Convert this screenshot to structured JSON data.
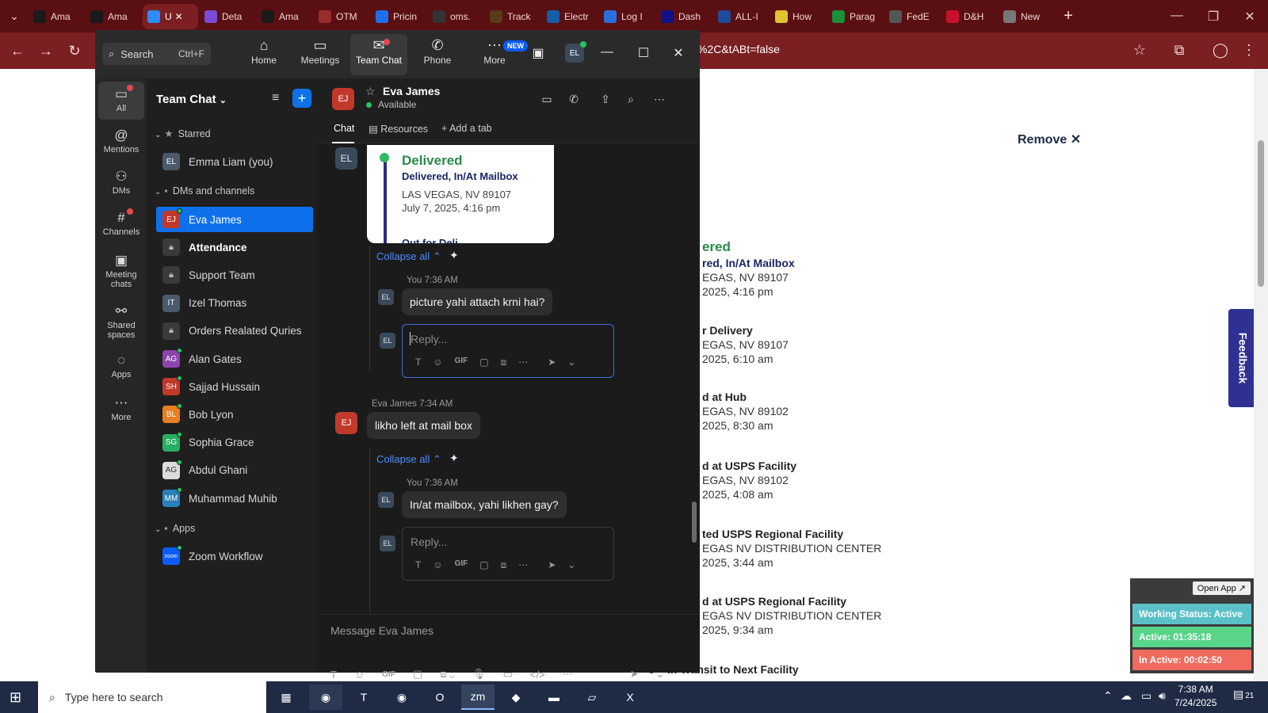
{
  "browser": {
    "tabs": [
      {
        "label": "Ama",
        "icon": "amazon-icon",
        "color": "#1a1a1a"
      },
      {
        "label": "Ama",
        "icon": "amazon-icon",
        "color": "#1a1a1a"
      },
      {
        "label": "U",
        "icon": "zoom-app-icon",
        "color": "#2d8cff",
        "active": true
      },
      {
        "label": "Deta",
        "icon": "page-icon",
        "color": "#7a4bd6"
      },
      {
        "label": "Ama",
        "icon": "amazon-icon",
        "color": "#1a1a1a"
      },
      {
        "label": "OTM",
        "icon": "otm-icon",
        "color": "#9b2c2c"
      },
      {
        "label": "Pricin",
        "icon": "pricing-icon",
        "color": "#1f6feb"
      },
      {
        "label": "oms.",
        "icon": "oms-icon",
        "color": "#333"
      },
      {
        "label": "Track",
        "icon": "ups-icon",
        "color": "#5a3a1a"
      },
      {
        "label": "Electr",
        "icon": "ec-icon",
        "color": "#145ea8"
      },
      {
        "label": "Log I",
        "icon": "login-icon",
        "color": "#2a6fdb"
      },
      {
        "label": "Dash",
        "icon": "dashboard-icon",
        "color": "#118"
      },
      {
        "label": "ALL-I",
        "icon": "seventeen-icon",
        "color": "#1f4a9c"
      },
      {
        "label": "How",
        "icon": "how-icon",
        "color": "#e0c32f"
      },
      {
        "label": "Parag",
        "icon": "sheets-icon",
        "color": "#1a8f3c"
      },
      {
        "label": "FedE",
        "icon": "fedex-icon",
        "color": "#555"
      },
      {
        "label": "D&H",
        "icon": "dh-icon",
        "color": "#c8102e"
      },
      {
        "label": "New",
        "icon": "newtab-icon",
        "color": "#777"
      }
    ],
    "url": "%2C&tABt=false"
  },
  "webpage": {
    "remove_label": "Remove ✕",
    "feedback_label": "Feedback",
    "tracking_events": [
      {
        "title": "ered",
        "line1": "red, In/At Mailbox",
        "line2": "EGAS, NV 89107",
        "line3": "2025, 4:16 pm",
        "green": true
      },
      {
        "title": "r Delivery",
        "line1": "EGAS, NV 89107",
        "line2": "2025, 6:10 am"
      },
      {
        "title": "d at Hub",
        "line1": "EGAS, NV 89102",
        "line2": "2025, 8:30 am"
      },
      {
        "title": "d at USPS Facility",
        "line1": "EGAS, NV 89102",
        "line2": "2025, 4:08 am"
      },
      {
        "title": "ted USPS Regional Facility",
        "line1": "EGAS NV DISTRIBUTION CENTER",
        "line2": "2025, 3:44 am"
      },
      {
        "title": "d at USPS Regional Facility",
        "line1": "EGAS NV DISTRIBUTION CENTER",
        "line2": "2025, 9:34 am"
      },
      {
        "title": "In Transit to Next Facility"
      }
    ],
    "status_widget": {
      "open_app": "Open App ↗",
      "working_status": "Working Status: Active",
      "active": "Active: 01:35:18",
      "inactive": "In Active: 00:02:50"
    }
  },
  "zoom": {
    "search_label": "Search",
    "search_shortcut": "Ctrl+F",
    "top_tabs": [
      {
        "label": "Home",
        "icon": "home-icon"
      },
      {
        "label": "Meetings",
        "icon": "video-icon"
      },
      {
        "label": "Team Chat",
        "icon": "chat-icon",
        "active": true
      },
      {
        "label": "Phone",
        "icon": "phone-icon"
      },
      {
        "label": "More",
        "icon": "more-icon"
      }
    ],
    "new_badge": "NEW",
    "avatar_initials": "EL",
    "rail": [
      {
        "label": "All",
        "icon": "chat-bubble-icon",
        "active": true
      },
      {
        "label": "Mentions",
        "icon": "at-icon"
      },
      {
        "label": "DMs",
        "icon": "people-icon"
      },
      {
        "label": "Channels",
        "icon": "hash-icon"
      },
      {
        "label": "Meeting chats",
        "icon": "calendar-icon"
      },
      {
        "label": "Shared spaces",
        "icon": "shared-icon"
      },
      {
        "label": "Apps",
        "icon": "apps-icon"
      },
      {
        "label": "More",
        "icon": "ellipsis-icon"
      }
    ],
    "list_title": "Team Chat",
    "sections": {
      "starred": "Starred",
      "dms": "DMs and channels",
      "apps": "Apps"
    },
    "starred_items": [
      {
        "initials": "EL",
        "name": "Emma Liam (you)",
        "color": "#4a5a6a"
      }
    ],
    "channels": [
      {
        "initials": "EJ",
        "name": "Eva James",
        "color": "#c0392b",
        "active": true,
        "online": true
      },
      {
        "name": "Attendance",
        "lock": true,
        "bold": true
      },
      {
        "name": "Support Team",
        "lock": true
      },
      {
        "initials": "IT",
        "name": "Izel Thomas",
        "color": "#4a5a6a"
      },
      {
        "name": "Orders Realated Quries",
        "lock": true
      },
      {
        "initials": "AG",
        "name": "Alan Gates",
        "color": "#8e44ad",
        "online": true
      },
      {
        "initials": "SH",
        "name": "Sajjad Hussain",
        "color": "#c0392b",
        "online": true
      },
      {
        "initials": "BL",
        "name": "Bob Lyon",
        "color": "#e67e22",
        "online": true
      },
      {
        "initials": "SG",
        "name": "Sophia Grace",
        "color": "#27ae60",
        "online": true
      },
      {
        "initials": "AG",
        "name": "Abdul Ghani",
        "color": "#dcdcdc",
        "online": true
      },
      {
        "initials": "MM",
        "name": "Muhammad Muhib",
        "color": "#2980b9",
        "online": true
      }
    ],
    "apps": [
      {
        "initials": "zoom",
        "name": "Zoom Workflow",
        "color": "#0b5cff",
        "online": true
      }
    ],
    "chat": {
      "contact_name": "Eva James",
      "contact_status": "Available",
      "contact_initials": "EJ",
      "tabs": [
        "Chat",
        "Resources",
        "Add a tab"
      ],
      "card": {
        "status": "Delivered",
        "subtitle": "Delivered, In/At Mailbox",
        "location": "LAS VEGAS, NV 89107",
        "datetime": "July 7, 2025, 4:16 pm",
        "next": "Out for Deli"
      },
      "collapse_label": "Collapse all",
      "msg1_meta": "You 7:36 AM",
      "msg1_text": "picture yahi attach krni hai?",
      "reply_placeholder": "Reply...",
      "msg2_meta": "Eva James 7:34 AM",
      "msg2_text": "likho left at mail box",
      "msg3_meta": "You 7:36 AM",
      "msg3_text": "In/at mailbox, yahi likhen gay?",
      "composer_placeholder": "Message Eva James",
      "gif_label": "GIF"
    }
  },
  "taskbar": {
    "search_placeholder": "Type here to search",
    "time": "7:38 AM",
    "date": "7/24/2025",
    "notif_count": "21"
  }
}
